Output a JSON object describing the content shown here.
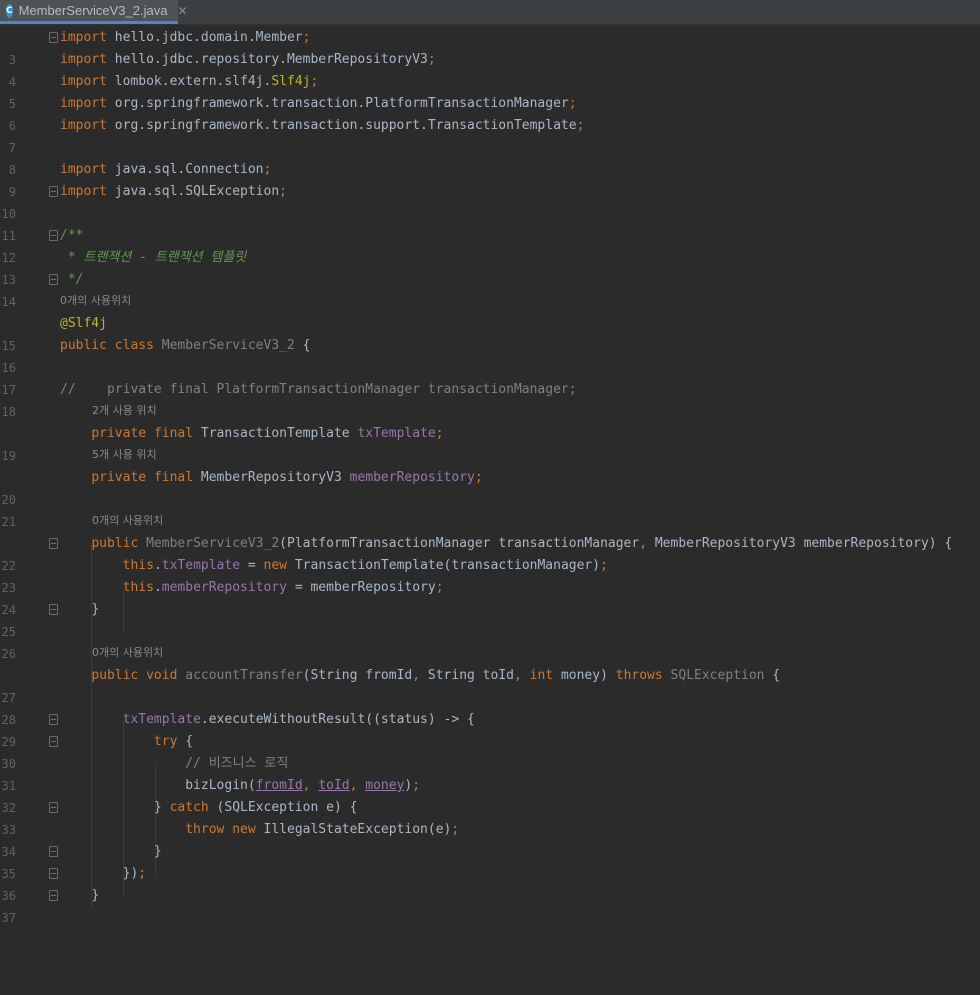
{
  "tab": {
    "title": "MemberServiceV3_2.java",
    "icon": "C",
    "close": "✕"
  },
  "lines": {
    "n3": "3",
    "n4": "4",
    "n5": "5",
    "n6": "6",
    "n7": "7",
    "n8": "8",
    "n9": "9",
    "n10": "10",
    "n11": "11",
    "n12": "12",
    "n13": "13",
    "n14": "14",
    "n15": "15",
    "n16": "16",
    "n17": "17",
    "n18": "18",
    "n19": "19",
    "n20": "20",
    "n21": "21",
    "n22": "22",
    "n23": "23",
    "n24": "24",
    "n25": "25",
    "n26": "26",
    "n27": "27",
    "n28": "28",
    "n29": "29",
    "n30": "30",
    "n31": "31",
    "n32": "32",
    "n33": "33",
    "n34": "34",
    "n35": "35",
    "n36": "36",
    "n37": "37"
  },
  "hints": {
    "class_usages": "0개의 사용위치",
    "tx_usages": "2개 사용 위치",
    "repo_usages": "5개 사용 위치",
    "ctor_usages": "0개의 사용위치",
    "method_usages": "0개의 사용위치"
  },
  "code": {
    "kw_import": "import",
    "imp1": "hello.jdbc.domain.Member",
    "imp2": "hello.jdbc.repository.MemberRepositoryV3",
    "imp3": "lombok.extern.slf4j.",
    "imp3b": "Slf4j",
    "imp4": "org.springframework.transaction.PlatformTransactionManager",
    "imp5": "org.springframework.transaction.support.TransactionTemplate",
    "imp6": "java.sql.Connection",
    "imp7": "java.sql.SQLException",
    "semi": ";",
    "doc1": "/**",
    "doc2": " * 트랜잭션 - 트랜잭션 템플릿",
    "doc3": " */",
    "ann": "@Slf4j",
    "kw_public": "public",
    "kw_class": "class",
    "class_name": "MemberServiceV3_2",
    "brace_open": "{",
    "commented": "//    private final PlatformTransactionManager transactionManager;",
    "kw_private": "private",
    "kw_final": "final",
    "type_tt": "TransactionTemplate",
    "fld_tx": "txTemplate",
    "type_repo": "MemberRepositoryV3",
    "fld_repo": "memberRepository",
    "ctor_params_a": "(PlatformTransactionManager transactionManager",
    "ctor_params_b": " MemberRepositoryV3 memberRepository) {",
    "comma": ",",
    "kw_this": "this",
    "dot": ".",
    "assign_new": " = ",
    "kw_new": "new",
    "ctor_tt": " TransactionTemplate(transactionManager)",
    "assign_repo": " = memberRepository",
    "brace_close": "}",
    "kw_void": "void",
    "method_name": "accountTransfer",
    "params_a": "(String fromId",
    "params_b": " String toId",
    "kw_int": "int",
    "params_c": " money) ",
    "kw_throws": "throws",
    "sqlex": "SQLException",
    "space_brace": " {",
    "exec": ".executeWithoutResult((status) -> {",
    "kw_try": "try",
    "comment_biz": "// 비즈니스 로직",
    "biz_call": "bizLogin(",
    "arg_from": "fromId",
    "arg_to": "toId",
    "arg_money": "money",
    "close_paren": ")",
    "catch_pre": "} ",
    "kw_catch": "catch",
    "catch_post": " (SQLException e) {",
    "kw_throw": "throw",
    "ise": " IllegalStateException(e)",
    "close_lambda": "})"
  }
}
